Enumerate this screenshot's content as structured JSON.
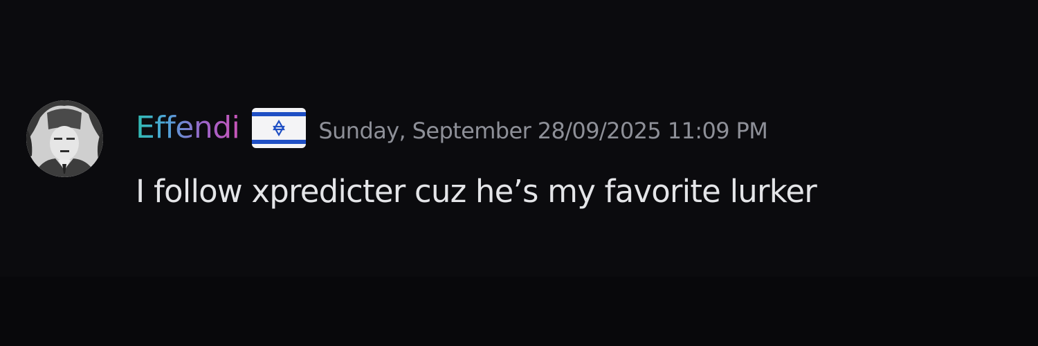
{
  "message": {
    "author": {
      "name": "Effendi",
      "avatar_icon": "user-avatar-portrait",
      "badge_icon": "israel-flag-icon",
      "name_gradient": [
        "#2fbcb0",
        "#4fa3d8",
        "#9b64c8",
        "#c955b8"
      ]
    },
    "timestamp": "Sunday, September 28/09/2025 11:09 PM",
    "text": "I follow xpredicter cuz he’s my favorite lurker"
  },
  "colors": {
    "background": "#0b0b0e",
    "timestamp": "#8e9098",
    "message_text": "#e4e5e8",
    "flag_blue": "#1f4fc4"
  }
}
